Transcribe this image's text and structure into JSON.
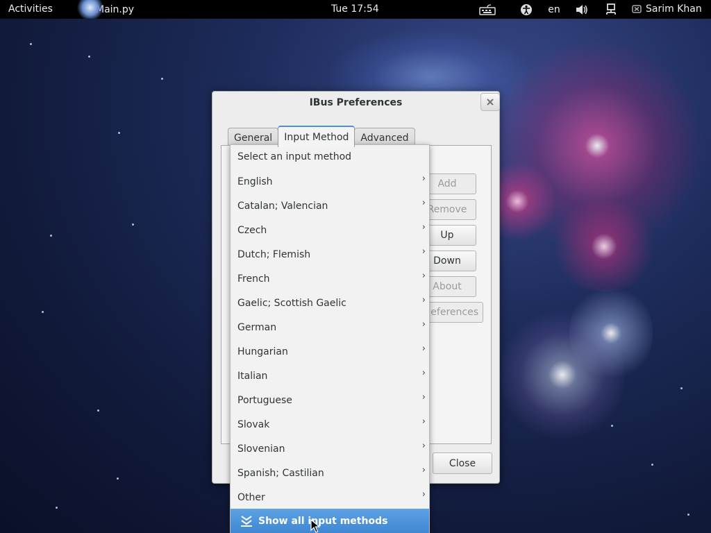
{
  "topbar": {
    "activities": "Activities",
    "app_name": "Main.py",
    "clock": "Tue 17:54",
    "language": "en",
    "user": "Sarim Khan"
  },
  "dialog": {
    "title": "IBus Preferences",
    "tabs": [
      "General",
      "Input Method",
      "Advanced"
    ],
    "active_tab": "Input Method",
    "buttons": {
      "add": "Add",
      "remove": "Remove",
      "up": "Up",
      "down": "Down",
      "about": "About",
      "preferences": "eferences"
    },
    "close": "Close"
  },
  "menu": {
    "header": "Select an input method",
    "items": [
      "English",
      "Catalan; Valencian",
      "Czech",
      "Dutch; Flemish",
      "French",
      "Gaelic; Scottish Gaelic",
      "German",
      "Hungarian",
      "Italian",
      "Portuguese",
      "Slovak",
      "Slovenian",
      "Spanish; Castilian",
      "Other"
    ],
    "show_all": "Show all input methods"
  },
  "colors": {
    "highlight": "#4a90d9",
    "topbar": "#000000"
  }
}
